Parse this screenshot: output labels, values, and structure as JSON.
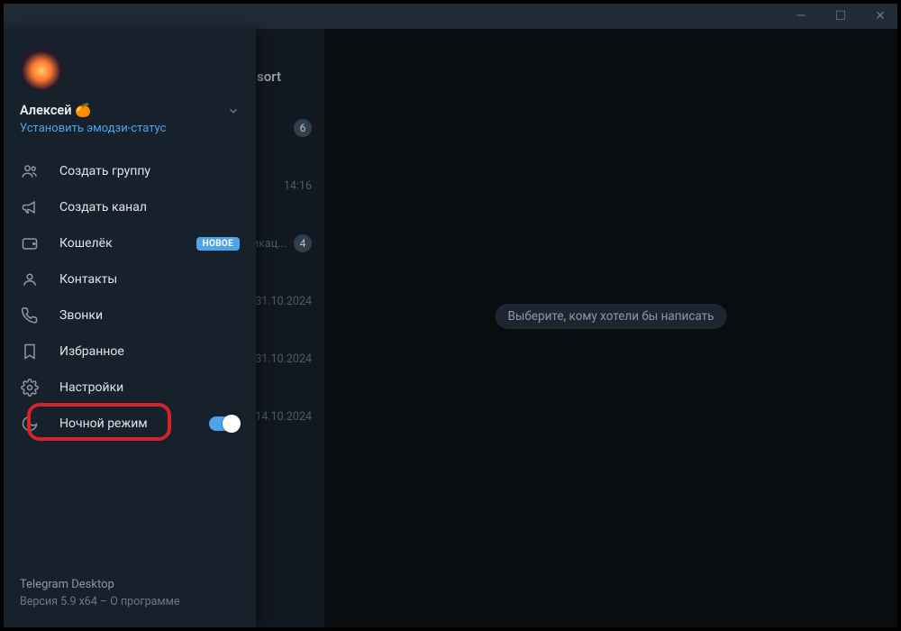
{
  "titlebar": {
    "min": "—",
    "max": "☐",
    "close": "✕"
  },
  "profile": {
    "name": "Алексей 🍊",
    "status_link": "Установить эмодзи-статус"
  },
  "menu": {
    "new_group": "Создать группу",
    "new_channel": "Создать канал",
    "wallet": "Кошелёк",
    "wallet_tag": "НОВОЕ",
    "contacts": "Контакты",
    "calls": "Звонки",
    "saved": "Избранное",
    "settings": "Настройки",
    "night": "Ночной режим"
  },
  "footer": {
    "app": "Telegram Desktop",
    "version": "Версия 5.9 x64 – О программе"
  },
  "chat_bg": {
    "top_label": "sort",
    "rows": [
      {
        "time": "",
        "badge": "6"
      },
      {
        "time": "14:16",
        "badge": ""
      },
      {
        "time": "",
        "text": "икац...",
        "badge": "4"
      },
      {
        "time": "31.10.2024",
        "badge": ""
      },
      {
        "time": "31.10.2024",
        "badge": ""
      },
      {
        "time": "14.10.2024",
        "badge": ""
      }
    ]
  },
  "chat_area": {
    "hint": "Выберите, кому хотели бы написать"
  }
}
